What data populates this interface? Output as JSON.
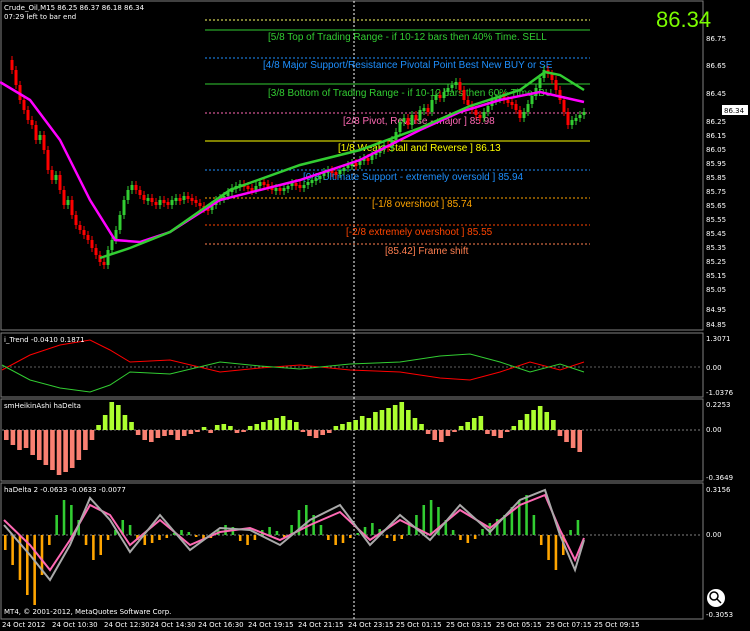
{
  "header": {
    "symbol_line": "Crude_Oil,M15  86.25 86.37 86.18 86.34",
    "timer_line": "07:29 left to bar end",
    "current_price": "86.34",
    "price_tag": "86.34"
  },
  "main_axis": {
    "ticks": [
      "86.75",
      "86.65",
      "86.45",
      "86.35",
      "86.25",
      "86.15",
      "86.05",
      "85.95",
      "85.85",
      "85.75",
      "85.65",
      "85.55",
      "85.45",
      "85.35",
      "85.25",
      "85.15",
      "85.05",
      "84.95",
      "84.85"
    ]
  },
  "murray_levels": [
    {
      "text": "[5/8  Top of Trading Range - if 10-12 bars then 40% Time. SELL",
      "color": "#32cd32"
    },
    {
      "text": "[4/8  Major Support/Resistance Pivotal Point Best New BUY or SE",
      "color": "#1e90ff"
    },
    {
      "text": "[3/8  Bottom of Trading Range - if 10-12 bars then 60% Time. BU",
      "color": "#32cd32"
    },
    {
      "text": "[2/8  Pivot, Reverse - major ]  85.98",
      "color": "#ff69b4"
    },
    {
      "text": "[1/8  Weak, Stall and Reverse ]  86.13",
      "color": "#ffff00"
    },
    {
      "text": "[0/8  Ultimate Support - extremely oversold ]  85.94",
      "color": "#1e90ff"
    },
    {
      "text": "[-1/8  overshoot ]  85.74",
      "color": "#ffa500"
    },
    {
      "text": "[-2/8  extremely overshoot ]  85.55",
      "color": "#ff4500"
    },
    {
      "text": "[85.42] Frame shift",
      "color": "#ff7f50"
    }
  ],
  "indicator_1": {
    "label": "i_Trend -0.0410 0.1871",
    "ticks": [
      "1.3071",
      "0.00",
      "-1.0376"
    ]
  },
  "indicator_2": {
    "label": "smHeikinAshi haDelta",
    "ticks": [
      "0.2253",
      "0.00",
      "-0.3649"
    ]
  },
  "indicator_3": {
    "label": "haDelta 2 -0.0633 -0.0633 -0.0077",
    "ticks": [
      "0.3156",
      "0.00",
      "-0.3053"
    ]
  },
  "copyright": "MT4, © 2001-2012, MetaQuotes Software Corp.",
  "time_axis": [
    "24 Oct 2012",
    "24 Oct 10:30",
    "24 Oct 12:30",
    "24 Oct 14:30",
    "24 Oct 16:30",
    "24 Oct 19:15",
    "24 Oct 21:15",
    "24 Oct 23:15",
    "25 Oct 01:15",
    "25 Oct 03:15",
    "25 Oct 05:15",
    "25 Oct 07:15",
    "25 Oct 09:15"
  ],
  "colors": {
    "bull": "#32cd32",
    "bear": "#ff0000",
    "ma1": "#ff00ff",
    "ma2": "#32cd32",
    "hist_pos": "#adff2f",
    "hist_neg": "#fa8072"
  },
  "icons": {
    "zoom": "zoom-icon"
  }
}
